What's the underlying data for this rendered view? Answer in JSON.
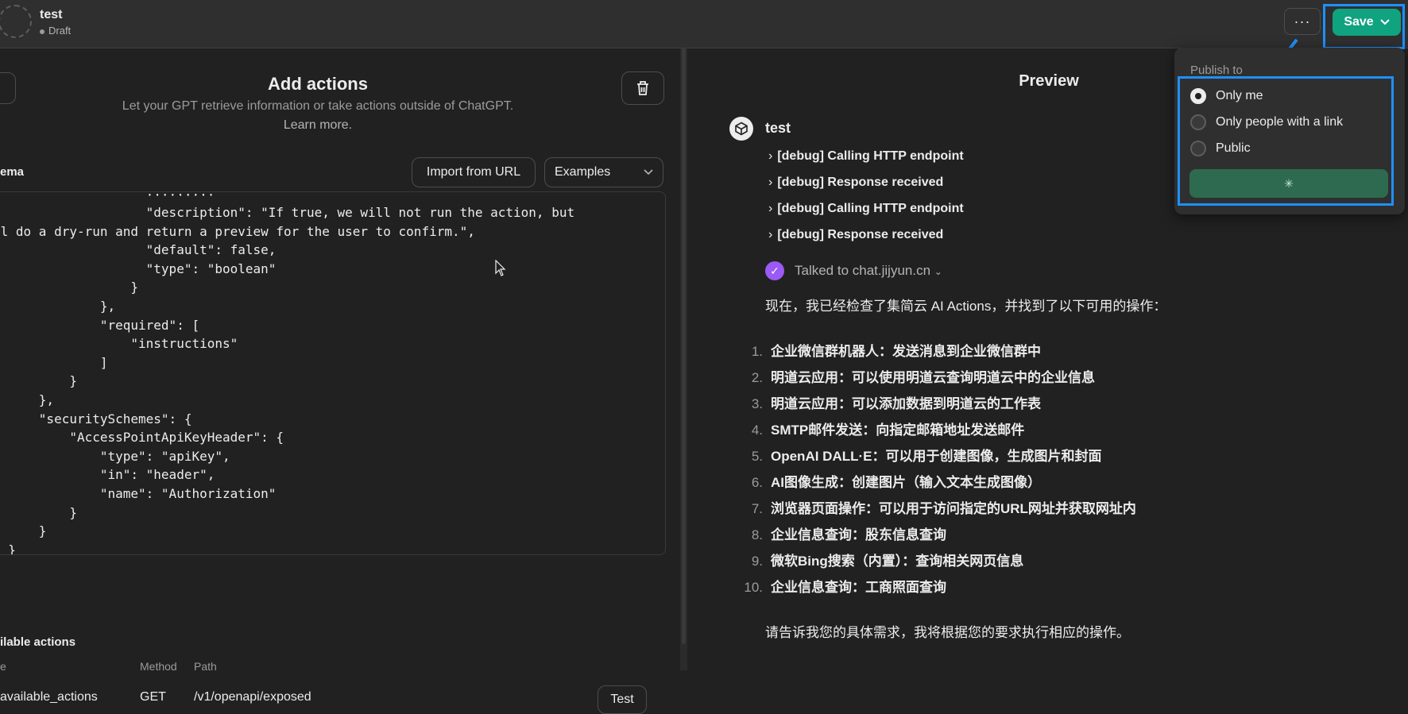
{
  "header": {
    "gpt_name": "test",
    "status": "Draft",
    "more_label": "···",
    "save_label": "Save"
  },
  "editor": {
    "title": "Add actions",
    "subtitle": "Let your GPT retrieve information or take actions outside of ChatGPT.",
    "learn_more": "Learn more.",
    "schema_label": "ema",
    "import_label": "Import from URL",
    "examples_label": "Examples",
    "code": [
      "                    \"description\": \"If true, we will not run the action, but",
      "ll do a dry-run and return a preview for the user to confirm.\",",
      "                    \"default\": false,",
      "                    \"type\": \"boolean\"",
      "                  }",
      "              },",
      "              \"required\": [",
      "                  \"instructions\"",
      "              ]",
      "          }",
      "      },",
      "      \"securitySchemes\": {",
      "          \"AccessPointApiKeyHeader\": {",
      "              \"type\": \"apiKey\",",
      "              \"in\": \"header\",",
      "              \"name\": \"Authorization\"",
      "          }",
      "      }",
      "  }"
    ],
    "available_label": "ilable actions",
    "columns": [
      "e",
      "Method",
      "Path"
    ],
    "action_row": {
      "name": "available_actions",
      "method": "GET",
      "path": "/v1/openapi/exposed",
      "test_label": "Test"
    }
  },
  "preview": {
    "title": "Preview",
    "bot_name": "test",
    "debug_lines": [
      "[debug] Calling HTTP endpoint",
      "[debug] Response received",
      "[debug] Calling HTTP endpoint",
      "[debug] Response received"
    ],
    "talked_to": "Talked to chat.jijyun.cn",
    "intro": "现在，我已经检查了集简云 AI Actions，并找到了以下可用的操作：",
    "items": [
      "企业微信群机器人：发送消息到企业微信群中",
      "明道云应用：可以使用明道云查询明道云中的企业信息",
      "明道云应用：可以添加数据到明道云的工作表",
      "SMTP邮件发送：向指定邮箱地址发送邮件",
      "OpenAI DALL·E：可以用于创建图像，生成图片和封面",
      "AI图像生成：创建图片（输入文本生成图像）",
      "浏览器页面操作：可以用于访问指定的URL网址并获取网址内",
      "企业信息查询：股东信息查询",
      "微软Bing搜索（内置）：查询相关网页信息",
      "企业信息查询：工商照面查询"
    ],
    "outro": "请告诉我您的具体需求，我将根据您的要求执行相应的操作。"
  },
  "publish": {
    "label": "Publish to",
    "options": [
      "Only me",
      "Only people with a link",
      "Public"
    ],
    "selected": "Only me"
  },
  "colors": {
    "accent": "#10a37f",
    "highlight": "#1e90ff",
    "check": "#9b59f5"
  }
}
